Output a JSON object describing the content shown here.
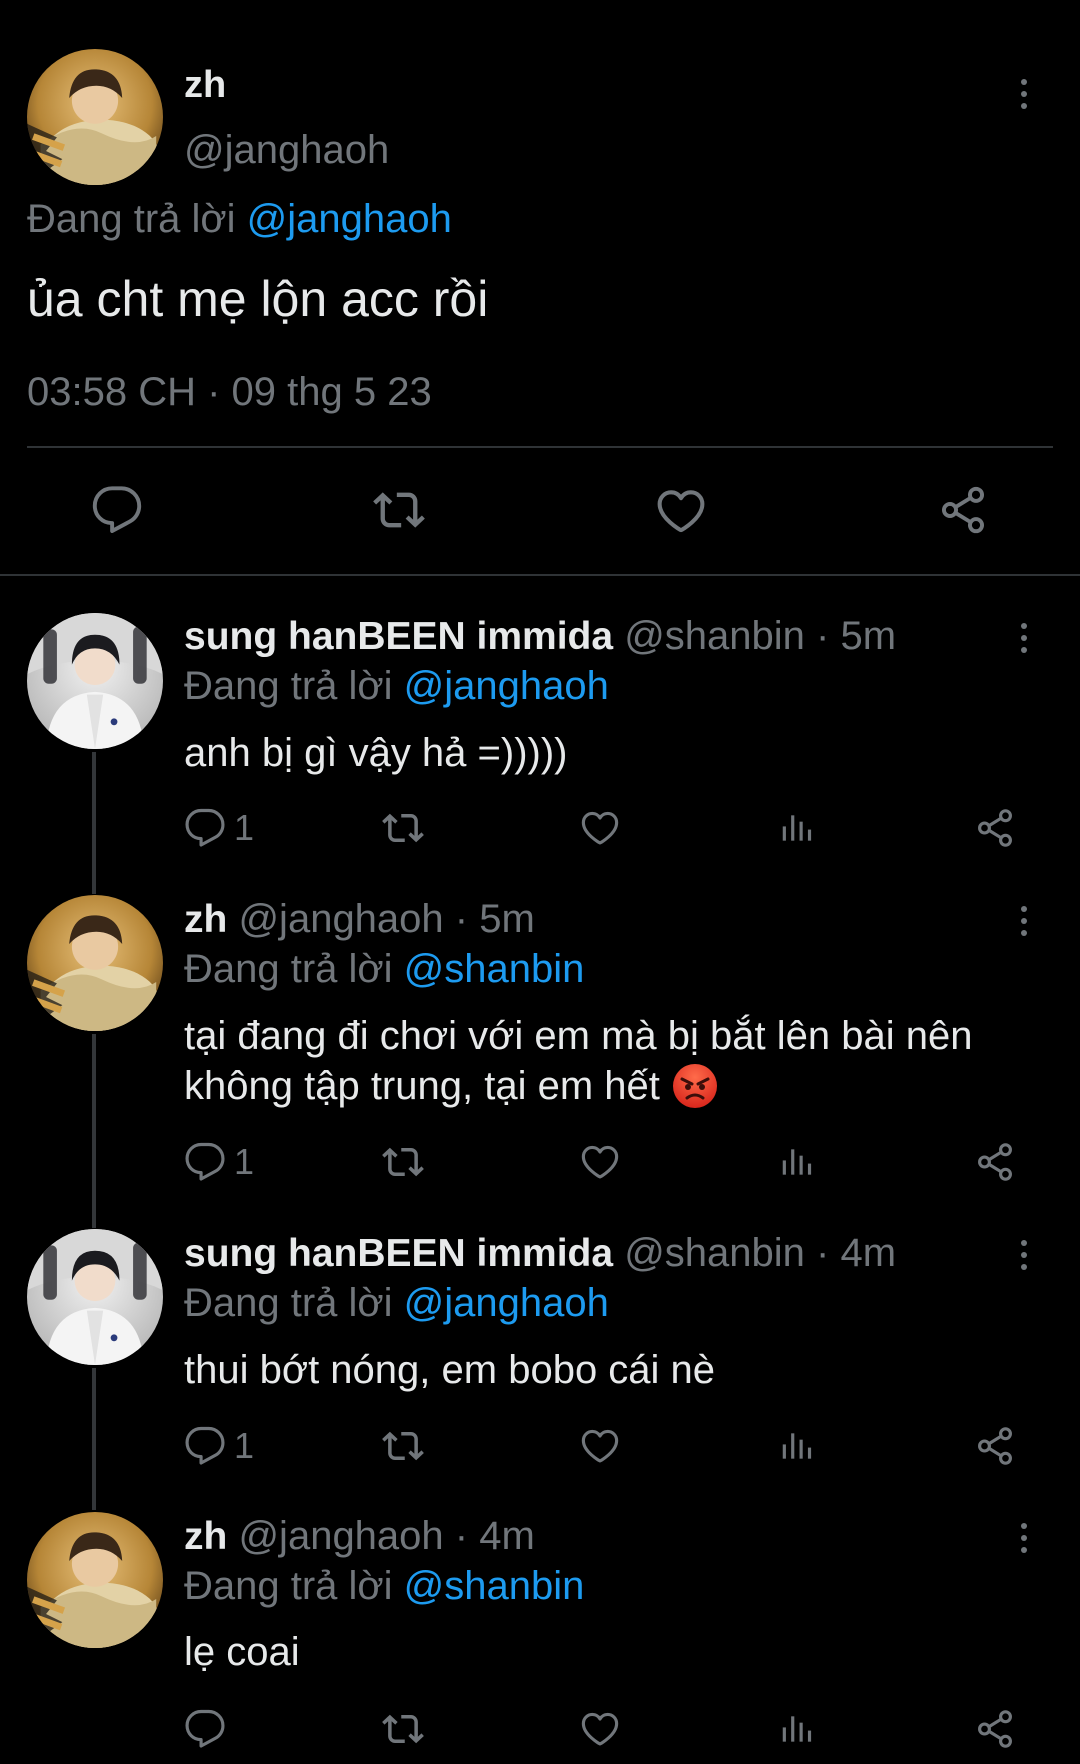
{
  "main_tweet": {
    "name": "zh",
    "handle": "@janghaoh",
    "replying_prefix": "Đang trả lời",
    "replying_to": "@janghaoh",
    "text": "ủa cht mẹ lộn acc rồi",
    "timestamp": "03:58 CH · 09 thg 5 23"
  },
  "replies": [
    {
      "name": "sung hanBEEN immida",
      "handle_time": "@shanbin · 5m",
      "replying_prefix": "Đang trả lời",
      "replying_to": "@janghaoh",
      "text": "anh bị gì vậy hả =)))))",
      "reply_count": "1"
    },
    {
      "name": "zh",
      "handle_time": "@janghaoh · 5m",
      "replying_prefix": "Đang trả lời",
      "replying_to": "@shanbin",
      "text_line1": "tại đang đi chơi với em mà bị bắt lên bài nên",
      "text_line2": "không tập trung, tại em hết",
      "reply_count": "1"
    },
    {
      "name": "sung hanBEEN immida",
      "handle_time": "@shanbin · 4m",
      "replying_prefix": "Đang trả lời",
      "replying_to": "@janghaoh",
      "text": "thui bớt nóng, em bobo cái nè",
      "reply_count": "1"
    },
    {
      "name": "zh",
      "handle_time": "@janghaoh · 4m",
      "replying_prefix": "Đang trả lời",
      "replying_to": "@shanbin",
      "text": "lẹ coai",
      "reply_count": ""
    }
  ],
  "colors": {
    "background": "#000000",
    "text": "#e7e9ea",
    "muted": "#71767b",
    "link": "#1d9bf0",
    "divider": "#2f3336"
  },
  "icons": [
    "more-icon",
    "reply-icon",
    "retweet-icon",
    "like-icon",
    "share-icon",
    "views-icon",
    "angry-face-emoji-icon"
  ]
}
